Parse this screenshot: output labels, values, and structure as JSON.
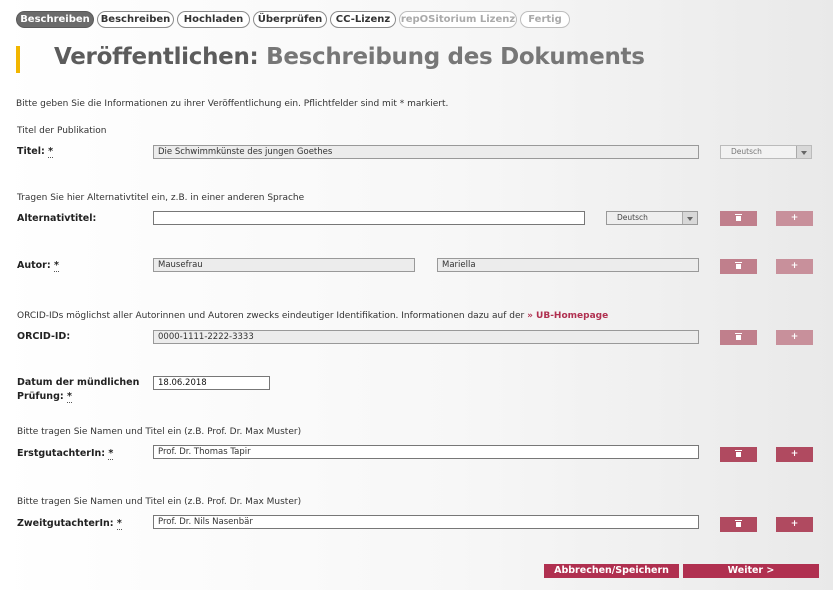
{
  "tabs": [
    {
      "label": "Beschreiben",
      "state": "active"
    },
    {
      "label": "Beschreiben",
      "state": "normal"
    },
    {
      "label": "Hochladen",
      "state": "normal"
    },
    {
      "label": "Überprüfen",
      "state": "normal"
    },
    {
      "label": "CC-Lizenz",
      "state": "normal"
    },
    {
      "label": "repOSitorium Lizenz",
      "state": "disabled"
    },
    {
      "label": "Fertig",
      "state": "disabled"
    }
  ],
  "page": {
    "title_part1": "Veröffentlichen: ",
    "title_part2": "Beschreibung des Dokuments",
    "intro": "Bitte geben Sie die Informationen zu ihrer Veröffentlichung ein. Pflichtfelder sind mit * markiert.",
    "accent_color": "#f2b600",
    "brand_color": "#b03050"
  },
  "form": {
    "titel": {
      "hint": "Titel der Publikation",
      "label": "Titel:",
      "required_mark": "*",
      "value": "Die Schwimmkünste des jungen Goethes",
      "language": "Deutsch"
    },
    "alternativtitel": {
      "hint": "Tragen Sie hier Alternativtitel ein, z.B. in einer anderen Sprache",
      "label": "Alternativtitel:",
      "value": "",
      "language": "Deutsch"
    },
    "autor": {
      "label": "Autor:",
      "required_mark": "*",
      "lastname": "Mausefrau",
      "firstname": "Mariella"
    },
    "orcid": {
      "hint": "ORCID-IDs möglichst aller Autorinnen und Autoren zwecks eindeutiger Identifikation. Informationen dazu auf der",
      "link_arrows": "»",
      "link_text": "UB-Homepage",
      "label": "ORCID-ID:",
      "value": "0000-1111-2222-3333"
    },
    "datum": {
      "label_line1": "Datum der mündlichen",
      "label_line2": "Prüfung:",
      "required_mark": "*",
      "value": "18.06.2018"
    },
    "erstgutachter": {
      "hint": "Bitte tragen Sie Namen und Titel ein (z.B. Prof. Dr. Max Muster)",
      "label": "ErstgutachterIn:",
      "required_mark": "*",
      "value": "Prof. Dr. Thomas Tapir"
    },
    "zweitgutachter": {
      "hint": "Bitte tragen Sie Namen und Titel ein (z.B. Prof. Dr. Max Muster)",
      "label": "ZweitgutachterIn:",
      "required_mark": "*",
      "value": "Prof. Dr. Nils Nasenbär"
    }
  },
  "buttons": {
    "add_symbol": "+",
    "cancel_save": "Abbrechen/Speichern",
    "next": "Weiter >"
  }
}
